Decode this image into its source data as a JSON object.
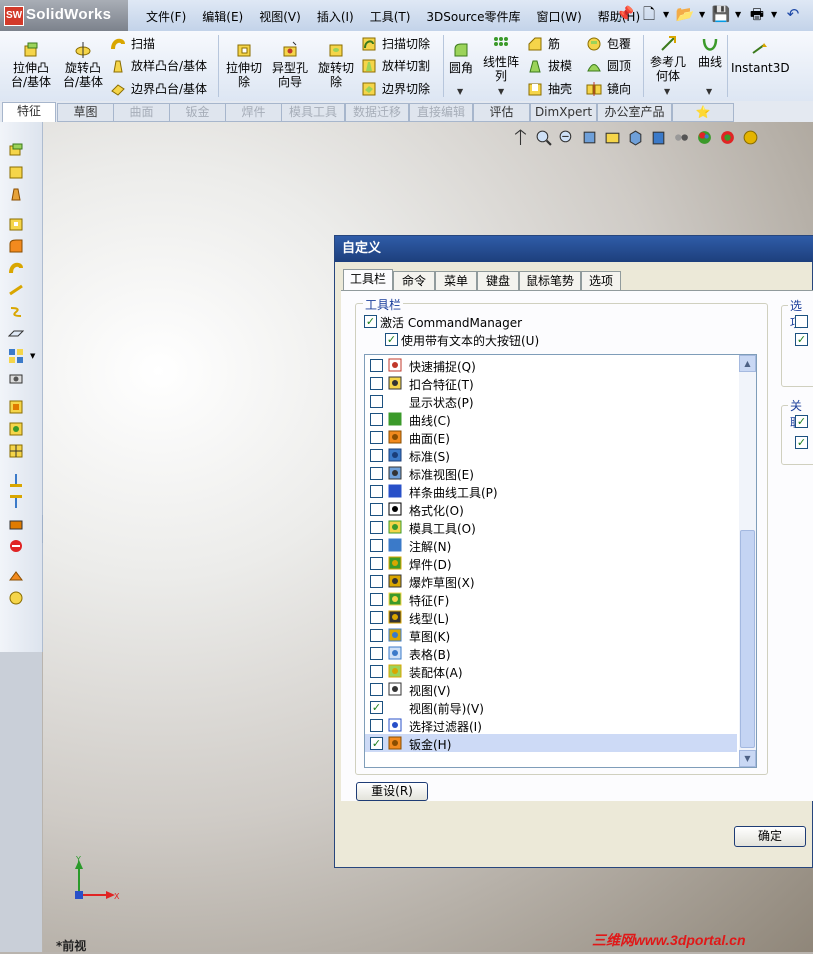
{
  "app": {
    "logo_text": "SolidWorks",
    "logo_badge": "SW"
  },
  "menu": [
    "文件(F)",
    "编辑(E)",
    "视图(V)",
    "插入(I)",
    "工具(T)",
    "3DSource零件库",
    "窗口(W)",
    "帮助(H)"
  ],
  "commands": {
    "extrude_boss": "拉伸凸\n台/基体",
    "revolve_boss": "旋转凸\n台/基体",
    "sweep": "扫描",
    "loft": "放样凸台/基体",
    "boundary": "边界凸台/基体",
    "extrude_cut": "拉伸切\n除",
    "hole_wizard": "异型孔\n向导",
    "revolve_cut": "旋转切\n除",
    "sweep_cut": "扫描切除",
    "loft_cut": "放样切割",
    "boundary_cut": "边界切除",
    "fillet": "圆角",
    "linear_pattern": "线性阵\n列",
    "rib": "筋",
    "draft": "拔模",
    "shell": "抽壳",
    "wrap": "包覆",
    "dome": "圆顶",
    "mirror": "镜向",
    "ref_geometry": "参考几\n何体",
    "curves": "曲线",
    "instant3d": "Instant3D"
  },
  "tabs": [
    {
      "label": "特征",
      "state": "active"
    },
    {
      "label": "草图",
      "state": "normal"
    },
    {
      "label": "曲面",
      "state": "disabled"
    },
    {
      "label": "钣金",
      "state": "disabled"
    },
    {
      "label": "焊件",
      "state": "disabled"
    },
    {
      "label": "模具工具",
      "state": "disabled"
    },
    {
      "label": "数据迁移",
      "state": "disabled"
    },
    {
      "label": "直接编辑",
      "state": "disabled"
    },
    {
      "label": "评估",
      "state": "normal"
    },
    {
      "label": "DimXpert",
      "state": "normal"
    },
    {
      "label": "办公室产品",
      "state": "normal"
    }
  ],
  "dialog": {
    "title": "自定义",
    "tabs": [
      "工具栏",
      "命令",
      "菜单",
      "键盘",
      "鼠标笔势",
      "选项"
    ],
    "toolbars_group": "工具栏",
    "activate_cm": "激活 CommandManager",
    "activate_cm_checked": true,
    "large_buttons": "使用带有文本的大按钮(U)",
    "large_buttons_checked": true,
    "options_group": "选项",
    "related_group": "关联",
    "reset_button": "重设(R)",
    "ok_button": "确定",
    "toolbar_list": [
      {
        "label": "快速捕捉(Q)",
        "checked": false,
        "icon": "quick-snap-icon"
      },
      {
        "label": "扣合特征(T)",
        "checked": false,
        "icon": "fastening-feature-icon"
      },
      {
        "label": "显示状态(P)",
        "checked": false,
        "icon": ""
      },
      {
        "label": "曲线(C)",
        "checked": false,
        "icon": "curves-icon"
      },
      {
        "label": "曲面(E)",
        "checked": false,
        "icon": "surfaces-icon"
      },
      {
        "label": "标准(S)",
        "checked": false,
        "icon": "standard-icon"
      },
      {
        "label": "标准视图(E)",
        "checked": false,
        "icon": "standard-views-icon"
      },
      {
        "label": "样条曲线工具(P)",
        "checked": false,
        "icon": "spline-tools-icon"
      },
      {
        "label": "格式化(O)",
        "checked": false,
        "icon": "format-icon"
      },
      {
        "label": "模具工具(O)",
        "checked": false,
        "icon": "mold-tools-icon"
      },
      {
        "label": "注解(N)",
        "checked": false,
        "icon": "annotation-icon"
      },
      {
        "label": "焊件(D)",
        "checked": false,
        "icon": "weldments-icon"
      },
      {
        "label": "爆炸草图(X)",
        "checked": false,
        "icon": "explode-sketch-icon"
      },
      {
        "label": "特征(F)",
        "checked": false,
        "icon": "features-icon"
      },
      {
        "label": "线型(L)",
        "checked": false,
        "icon": "line-format-icon"
      },
      {
        "label": "草图(K)",
        "checked": false,
        "icon": "sketch-icon"
      },
      {
        "label": "表格(B)",
        "checked": false,
        "icon": "table-icon"
      },
      {
        "label": "装配体(A)",
        "checked": false,
        "icon": "assembly-icon"
      },
      {
        "label": "视图(V)",
        "checked": false,
        "icon": "view-icon"
      },
      {
        "label": "视图(前导)(V)",
        "checked": true,
        "icon": ""
      },
      {
        "label": "选择过滤器(I)",
        "checked": false,
        "icon": "selection-filter-icon"
      },
      {
        "label": "钣金(H)",
        "checked": true,
        "icon": "sheet-metal-icon",
        "selected": true
      }
    ]
  },
  "viewport": {
    "view_name": "*前视",
    "axis_y": "Y",
    "axis_x": "X"
  },
  "watermark": "三维网www.3dportal.cn",
  "colors": {
    "dialog_title": "#2f5ca8",
    "selection": "#cddaf6",
    "background": "#b9b4ae"
  }
}
